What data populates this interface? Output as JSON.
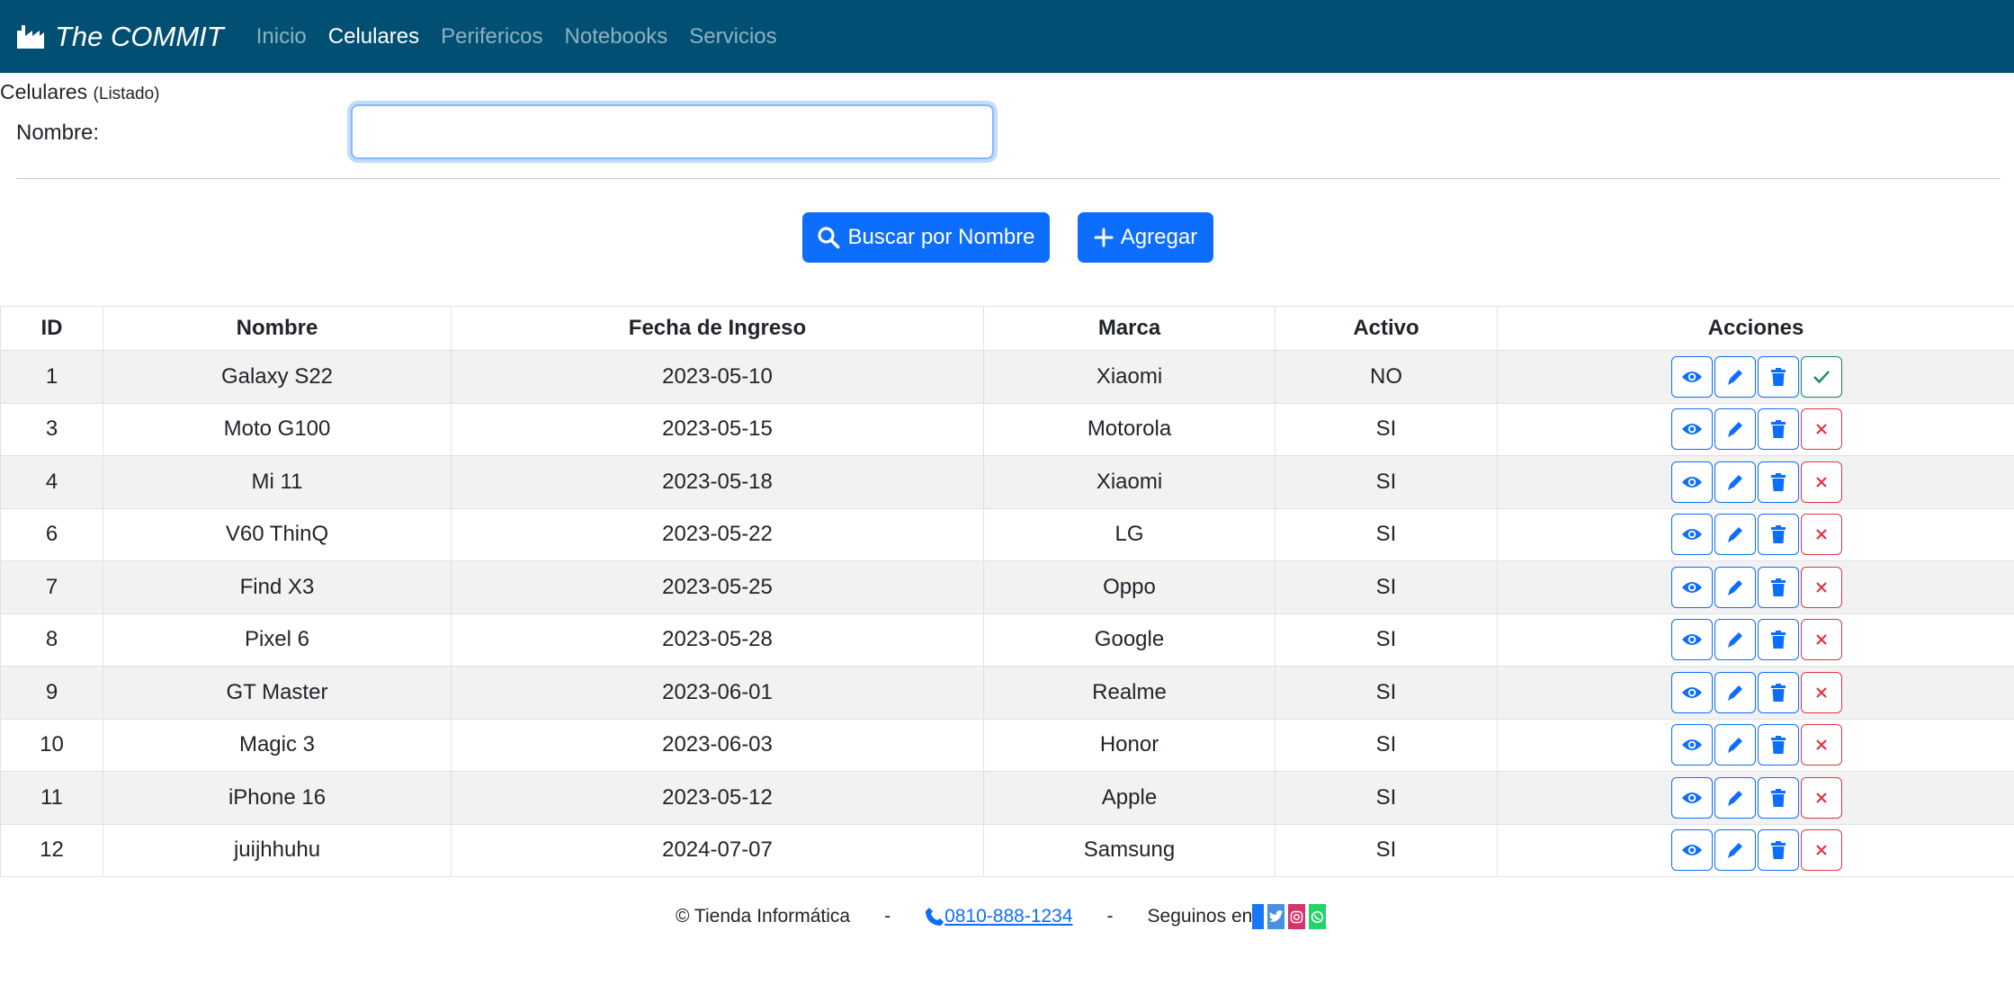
{
  "nav": {
    "brand": "The COMMIT",
    "links": [
      "Inicio",
      "Celulares",
      "Perifericos",
      "Notebooks",
      "Servicios"
    ]
  },
  "page": {
    "title": "Celulares",
    "subtitle": "(Listado)",
    "name_label": "Nombre:",
    "name_value": ""
  },
  "buttons": {
    "search": "Buscar por Nombre",
    "add": "Agregar"
  },
  "table": {
    "headers": [
      "ID",
      "Nombre",
      "Fecha de Ingreso",
      "Marca",
      "Activo",
      "Acciones"
    ],
    "rows": [
      {
        "id": "1",
        "nombre": "Galaxy S22",
        "fecha": "2023-05-10",
        "marca": "Xiaomi",
        "activo": "NO"
      },
      {
        "id": "3",
        "nombre": "Moto G100",
        "fecha": "2023-05-15",
        "marca": "Motorola",
        "activo": "SI"
      },
      {
        "id": "4",
        "nombre": "Mi 11",
        "fecha": "2023-05-18",
        "marca": "Xiaomi",
        "activo": "SI"
      },
      {
        "id": "6",
        "nombre": "V60 ThinQ",
        "fecha": "2023-05-22",
        "marca": "LG",
        "activo": "SI"
      },
      {
        "id": "7",
        "nombre": "Find X3",
        "fecha": "2023-05-25",
        "marca": "Oppo",
        "activo": "SI"
      },
      {
        "id": "8",
        "nombre": "Pixel 6",
        "fecha": "2023-05-28",
        "marca": "Google",
        "activo": "SI"
      },
      {
        "id": "9",
        "nombre": "GT Master",
        "fecha": "2023-06-01",
        "marca": "Realme",
        "activo": "SI"
      },
      {
        "id": "10",
        "nombre": "Magic 3",
        "fecha": "2023-06-03",
        "marca": "Honor",
        "activo": "SI"
      },
      {
        "id": "11",
        "nombre": "iPhone 16",
        "fecha": "2023-05-12",
        "marca": "Apple",
        "activo": "SI"
      },
      {
        "id": "12",
        "nombre": "juijhhuhu",
        "fecha": "2024-07-07",
        "marca": "Samsung",
        "activo": "SI"
      }
    ]
  },
  "footer": {
    "copyright": "© Tienda Informática",
    "sep1": "-",
    "phone": " 0810-888-1234 ",
    "sep2": "-",
    "follow": "Seguinos en"
  },
  "colors": {
    "navbar": "#015074",
    "primary": "#0d6efd",
    "success": "#198754",
    "danger": "#dc3545",
    "facebook": "#1877f2",
    "twitter": "#4a90e2",
    "instagram": "#d6336c",
    "whatsapp": "#25d366"
  }
}
